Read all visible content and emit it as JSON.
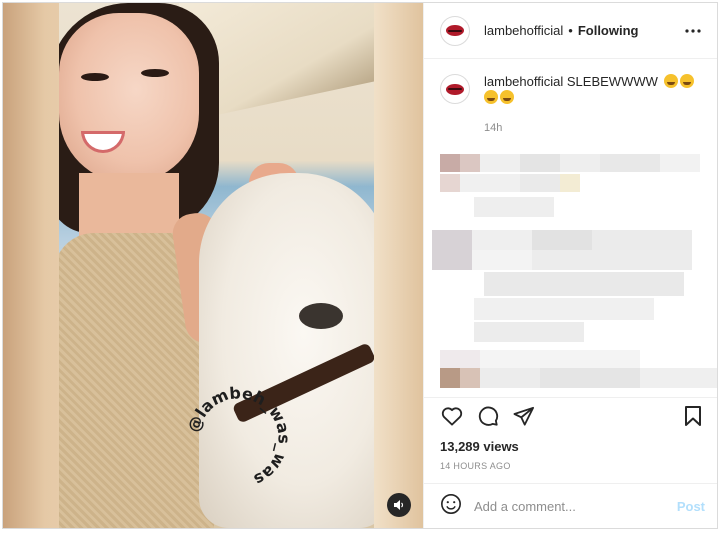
{
  "post": {
    "username": "lambehofficial",
    "separator": "•",
    "follow_status": "Following"
  },
  "caption": {
    "username": "lambehofficial",
    "text": "SLEBEWWWW",
    "emojis": [
      "joy-emoji",
      "rofl-emoji",
      "joy-emoji",
      "rofl-emoji"
    ],
    "time": "14h"
  },
  "media": {
    "watermark": "@lambeh_was_was"
  },
  "stats": {
    "views": "13,289 views",
    "posted_ago": "14 HOURS AGO"
  },
  "comment_box": {
    "placeholder": "Add a comment...",
    "post_label": "Post"
  },
  "colors": {
    "accent_disabled": "#b2dffc",
    "text": "#262626",
    "muted": "#8e8e8e",
    "border": "#dbdbdb"
  }
}
